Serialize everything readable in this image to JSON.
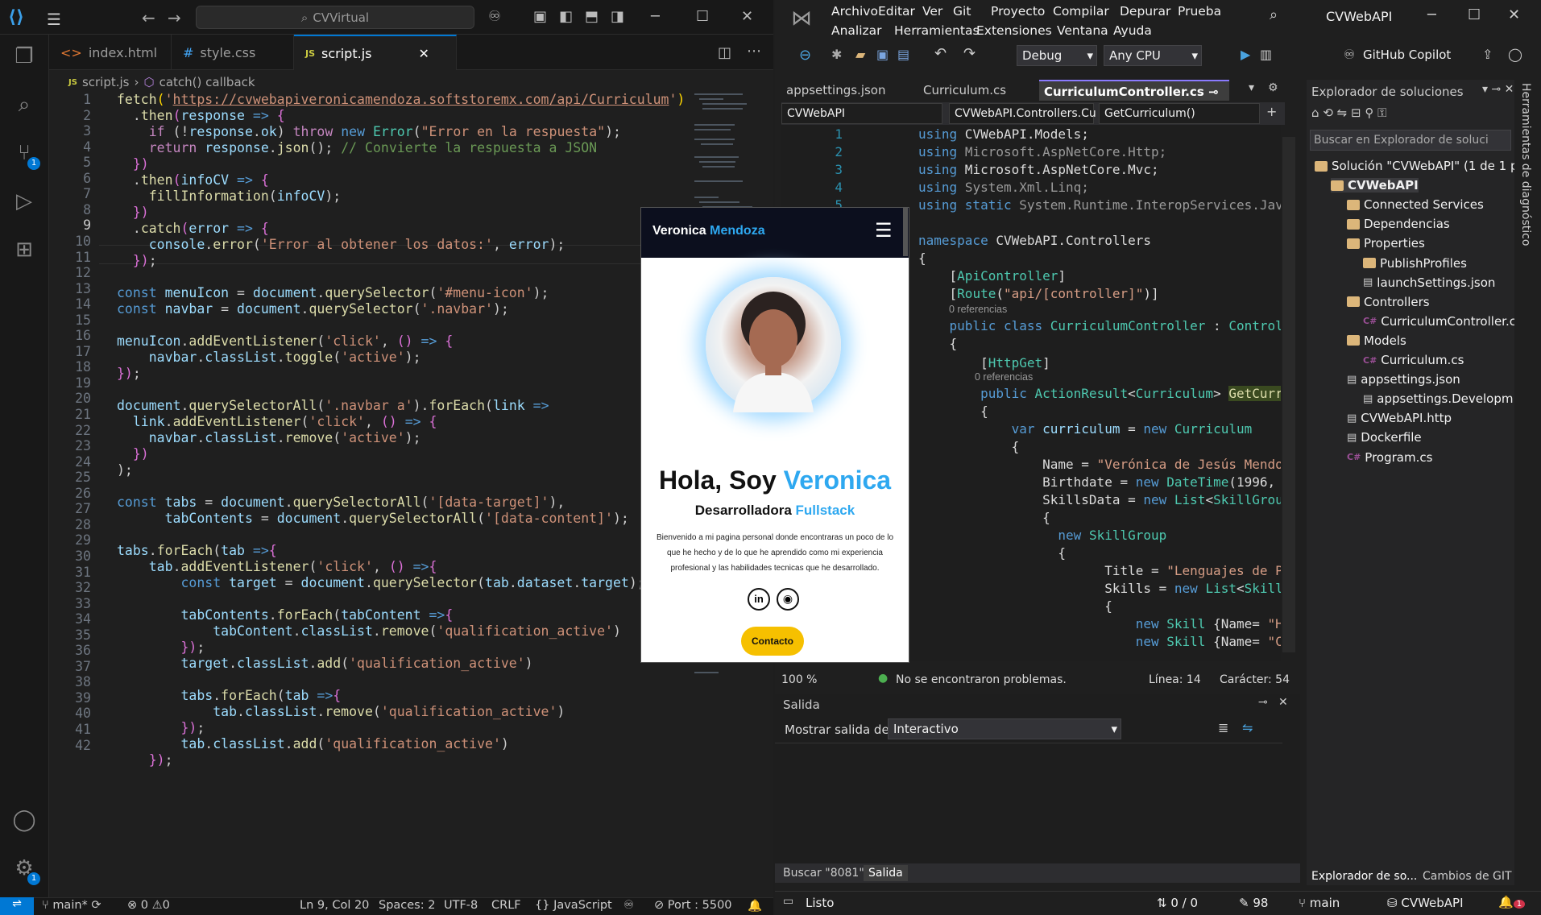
{
  "vscode": {
    "search_text": "CVVirtual",
    "tabs": [
      {
        "label": "index.html",
        "icon": "html-icon"
      },
      {
        "label": "style.css",
        "icon": "css-icon"
      },
      {
        "label": "script.js",
        "icon": "js-icon",
        "active": true
      }
    ],
    "breadcrumb": {
      "file": "script.js",
      "symbol": "catch() callback"
    },
    "line_numbers": [
      "1",
      "2",
      "3",
      "4",
      "5",
      "6",
      "7",
      "8",
      "9",
      "10",
      "11",
      "12",
      "13",
      "14",
      "15",
      "16",
      "17",
      "18",
      "19",
      "20",
      "21",
      "22",
      "23",
      "24",
      "25",
      "26",
      "27",
      "28",
      "29",
      "30",
      "31",
      "32",
      "33",
      "34",
      "35",
      "36",
      "37",
      "38",
      "39",
      "40",
      "41",
      "42"
    ],
    "status": {
      "branch": "main*",
      "errors": "0",
      "warnings": "0",
      "position": "Ln 9, Col 20",
      "spaces": "Spaces: 2",
      "encoding": "UTF-8",
      "eol": "CRLF",
      "language": "JavaScript",
      "port": "Port : 5500"
    },
    "badges": {
      "source_control": "1",
      "settings": "1"
    }
  },
  "preview": {
    "brand_first": "Veronica",
    "brand_second": "Mendoza",
    "greeting": "Hola, Soy",
    "name": "Veronica",
    "role_first": "Desarrolladora",
    "role_second": "Fullstack",
    "bio": "Bienvenido a mi pagina personal donde encontraras un poco de lo que he hecho y de lo que he aprendido como mi experiencia profesional y las habilidades tecnicas que he desarrollado.",
    "contact_button": "Contacto"
  },
  "vs": {
    "menu_row1": [
      "Archivo",
      "Editar",
      "Ver",
      "Git",
      "Proyecto",
      "Compilar",
      "Depurar",
      "Prueba"
    ],
    "menu_row2": [
      "Analizar",
      "Herramientas",
      "Extensiones",
      "Ventana",
      "Ayuda"
    ],
    "title": "CVWebAPI",
    "config": "Debug",
    "platform": "Any CPU",
    "copilot": "GitHub Copilot",
    "editor_tabs": [
      "appsettings.json",
      "Curriculum.cs",
      "CurriculumController.cs"
    ],
    "nav": {
      "project": "CVWebAPI",
      "class": "CVWebAPI.Controllers.Cu",
      "member": "GetCurriculum()"
    },
    "line_numbers": [
      "1",
      "2",
      "3",
      "4",
      "5"
    ],
    "refs": "0 referencias",
    "zoom": "100 %",
    "issues": "No se encontraron problemas.",
    "line_info": "Línea: 14",
    "char_info": "Carácter: 54",
    "output": {
      "title": "Salida",
      "show_label": "Mostrar salida de:",
      "source": "Interactivo",
      "tab_find": "Buscar \"8081\"",
      "tab_output": "Salida"
    },
    "solution_explorer": {
      "title": "Explorador de soluciones",
      "search_placeholder": "Buscar en Explorador de soluci",
      "items": [
        {
          "label": "Solución \"CVWebAPI\" (1 de 1 pr",
          "indent": 0
        },
        {
          "label": "CVWebAPI",
          "indent": 1,
          "bold": true
        },
        {
          "label": "Connected Services",
          "indent": 2
        },
        {
          "label": "Dependencias",
          "indent": 2
        },
        {
          "label": "Properties",
          "indent": 2
        },
        {
          "label": "PublishProfiles",
          "indent": 3
        },
        {
          "label": "launchSettings.json",
          "indent": 3
        },
        {
          "label": "Controllers",
          "indent": 2
        },
        {
          "label": "CurriculumController.c",
          "indent": 3
        },
        {
          "label": "Models",
          "indent": 2
        },
        {
          "label": "Curriculum.cs",
          "indent": 3
        },
        {
          "label": "appsettings.json",
          "indent": 2
        },
        {
          "label": "appsettings.Developm",
          "indent": 3
        },
        {
          "label": "CVWebAPI.http",
          "indent": 2
        },
        {
          "label": "Dockerfile",
          "indent": 2
        },
        {
          "label": "Program.cs",
          "indent": 2
        }
      ],
      "bottom_tabs": [
        "Explorador de so...",
        "Cambios de GIT"
      ]
    },
    "side_label": "Herramientas de diagnóstico",
    "status": {
      "ready": "Listo",
      "updown": "0 / 0",
      "edits": "98",
      "branch": "main",
      "project": "CVWebAPI",
      "notif": "1"
    }
  },
  "colors": {
    "vs_accent": "#8a7aff",
    "vscode_accent": "#0078d4",
    "name_blue": "#2ea8f0",
    "button_yellow": "#f6c000"
  }
}
